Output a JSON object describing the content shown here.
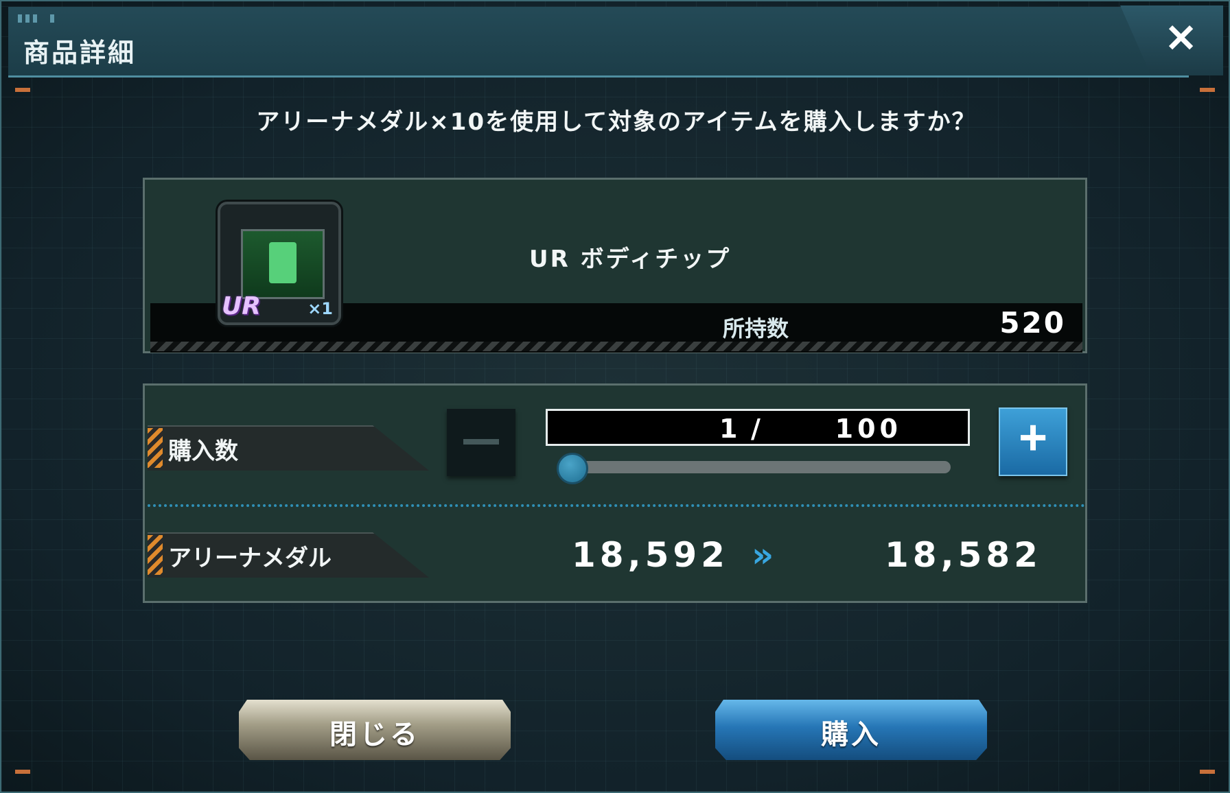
{
  "header": {
    "title": "商品詳細"
  },
  "prompt": "アリーナメダル×10を使用して対象のアイテムを購入しますか？",
  "item": {
    "name": "UR ボディチップ",
    "rarity_badge": "UR",
    "quantity_badge": "×1",
    "owned_label": "所持数",
    "owned_value": "520"
  },
  "purchase": {
    "quantity_label": "購入数",
    "quantity_current": "1",
    "quantity_separator": "/",
    "quantity_max": "100",
    "quantity_fraction": 0.01,
    "currency_label": "アリーナメダル",
    "currency_before": "18,592",
    "currency_after": "18,582"
  },
  "buttons": {
    "close_label": "閉じる",
    "buy_label": "購入"
  },
  "icons": {
    "close": "close-icon",
    "minus": "minus-icon",
    "plus": "plus-icon",
    "arrow": "double-chevron-right-icon"
  },
  "colors": {
    "accent_blue": "#2676b6",
    "header": "#1c3d48",
    "panel": "#1f3632",
    "stripe_orange": "#e08a2c"
  }
}
